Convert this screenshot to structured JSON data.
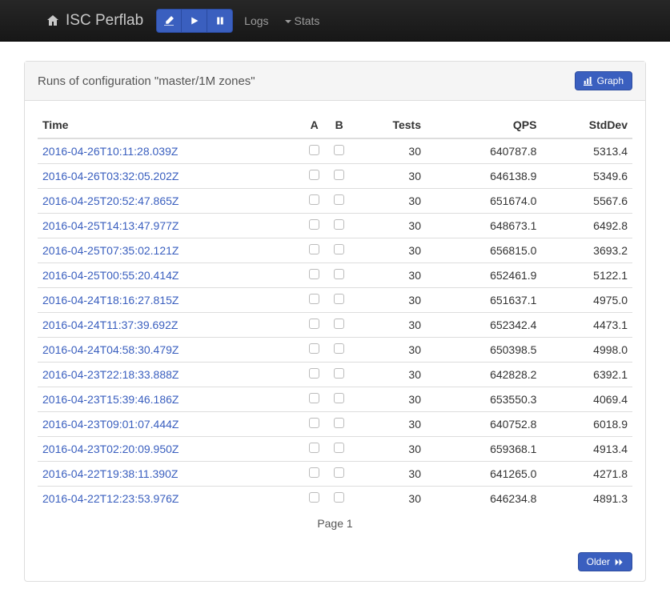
{
  "nav": {
    "brand": "ISC Perflab",
    "logs": "Logs",
    "stats": "Stats"
  },
  "panel": {
    "title": "Runs of configuration \"master/1M zones\"",
    "graph_btn": "Graph",
    "older_btn": "Older",
    "page_label": "Page 1"
  },
  "columns": {
    "time": "Time",
    "a": "A",
    "b": "B",
    "tests": "Tests",
    "qps": "QPS",
    "stddev": "StdDev"
  },
  "rows": [
    {
      "time": "2016-04-26T10:11:28.039Z",
      "tests": "30",
      "qps": "640787.8",
      "stddev": "5313.4"
    },
    {
      "time": "2016-04-26T03:32:05.202Z",
      "tests": "30",
      "qps": "646138.9",
      "stddev": "5349.6"
    },
    {
      "time": "2016-04-25T20:52:47.865Z",
      "tests": "30",
      "qps": "651674.0",
      "stddev": "5567.6"
    },
    {
      "time": "2016-04-25T14:13:47.977Z",
      "tests": "30",
      "qps": "648673.1",
      "stddev": "6492.8"
    },
    {
      "time": "2016-04-25T07:35:02.121Z",
      "tests": "30",
      "qps": "656815.0",
      "stddev": "3693.2"
    },
    {
      "time": "2016-04-25T00:55:20.414Z",
      "tests": "30",
      "qps": "652461.9",
      "stddev": "5122.1"
    },
    {
      "time": "2016-04-24T18:16:27.815Z",
      "tests": "30",
      "qps": "651637.1",
      "stddev": "4975.0"
    },
    {
      "time": "2016-04-24T11:37:39.692Z",
      "tests": "30",
      "qps": "652342.4",
      "stddev": "4473.1"
    },
    {
      "time": "2016-04-24T04:58:30.479Z",
      "tests": "30",
      "qps": "650398.5",
      "stddev": "4998.0"
    },
    {
      "time": "2016-04-23T22:18:33.888Z",
      "tests": "30",
      "qps": "642828.2",
      "stddev": "6392.1"
    },
    {
      "time": "2016-04-23T15:39:46.186Z",
      "tests": "30",
      "qps": "653550.3",
      "stddev": "4069.4"
    },
    {
      "time": "2016-04-23T09:01:07.444Z",
      "tests": "30",
      "qps": "640752.8",
      "stddev": "6018.9"
    },
    {
      "time": "2016-04-23T02:20:09.950Z",
      "tests": "30",
      "qps": "659368.1",
      "stddev": "4913.4"
    },
    {
      "time": "2016-04-22T19:38:11.390Z",
      "tests": "30",
      "qps": "641265.0",
      "stddev": "4271.8"
    },
    {
      "time": "2016-04-22T12:23:53.976Z",
      "tests": "30",
      "qps": "646234.8",
      "stddev": "4891.3"
    }
  ]
}
